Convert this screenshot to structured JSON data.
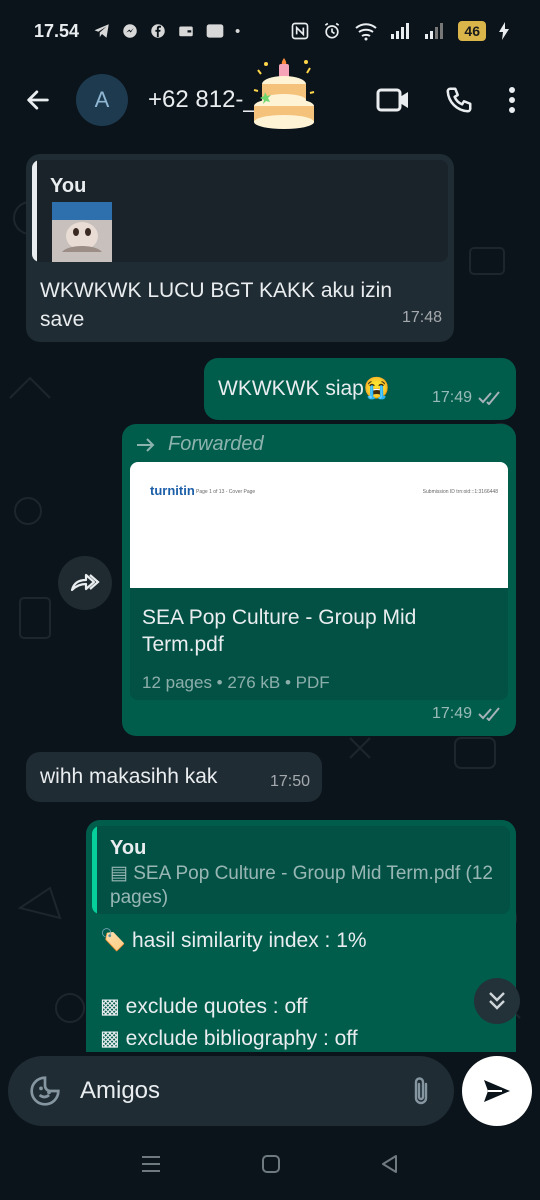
{
  "status_bar": {
    "time": "17.54",
    "battery": "46"
  },
  "header": {
    "avatar_initial": "A",
    "contact_name": "+62 812-___-..."
  },
  "messages": {
    "m1": {
      "quote_author": "You",
      "text": "WKWKWK LUCU BGT KAKK aku izin save",
      "time": "17:48"
    },
    "m2": {
      "text": "WKWKWK siap😭",
      "time": "17:49"
    },
    "m3": {
      "forwarded_label": "Forwarded",
      "preview_brand": "turnitin",
      "preview_page": "Page 1 of 13 - Cover Page",
      "preview_submission": "Submission ID  trn:oid:::1:3166448",
      "doc_title": "SEA Pop Culture - Group Mid Term.pdf",
      "doc_meta": "12 pages • 276 kB • PDF",
      "time": "17:49"
    },
    "m4": {
      "text": "wihh makasihh kak",
      "time": "17:50"
    },
    "m5": {
      "quote_author": "You",
      "quote_text": "SEA Pop Culture - Group Mid Term.pdf (12 pages)",
      "line1": "🏷️ hasil similarity index : 1%",
      "line2": "▩ exclude quotes : off",
      "line3": "▩ exclude bibliography : off"
    }
  },
  "composer": {
    "value": "Amigos"
  },
  "colors": {
    "background": "#0b141a",
    "incoming": "#202c33",
    "outgoing": "#005c4b",
    "accent_quote_you": "#06cf9c",
    "read_ticks": "#a6b2b8"
  },
  "icons": {
    "back": "arrow-left-icon",
    "video": "video-camera-icon",
    "call": "phone-icon",
    "menu": "more-vertical-icon",
    "forward": "forward-icon",
    "emoji": "sticker-icon",
    "attach": "paperclip-icon",
    "send": "send-icon"
  }
}
